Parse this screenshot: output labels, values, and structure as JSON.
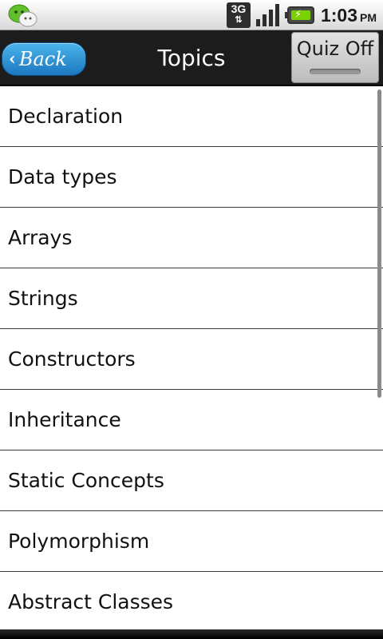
{
  "status_bar": {
    "app_icon": "chat-bubbles-icon",
    "network_label": "3G",
    "network_arrows": "⇅",
    "signal_icon": "signal-bars-icon",
    "battery_icon": "battery-charging-icon",
    "time": "1:03",
    "ampm": "PM"
  },
  "header": {
    "back_label": "Back",
    "back_chevron": "‹",
    "title": "Topics",
    "quiz_label": "Quiz Off",
    "quiz_state": "off"
  },
  "topics": [
    "Declaration",
    "Data types",
    "Arrays",
    "Strings",
    "Constructors",
    "Inheritance",
    "Static Concepts",
    "Polymorphism",
    "Abstract Classes"
  ],
  "colors": {
    "back_button": "#2f96d8",
    "title_bar": "#1c1c1c",
    "battery_fill": "#7ad100"
  }
}
